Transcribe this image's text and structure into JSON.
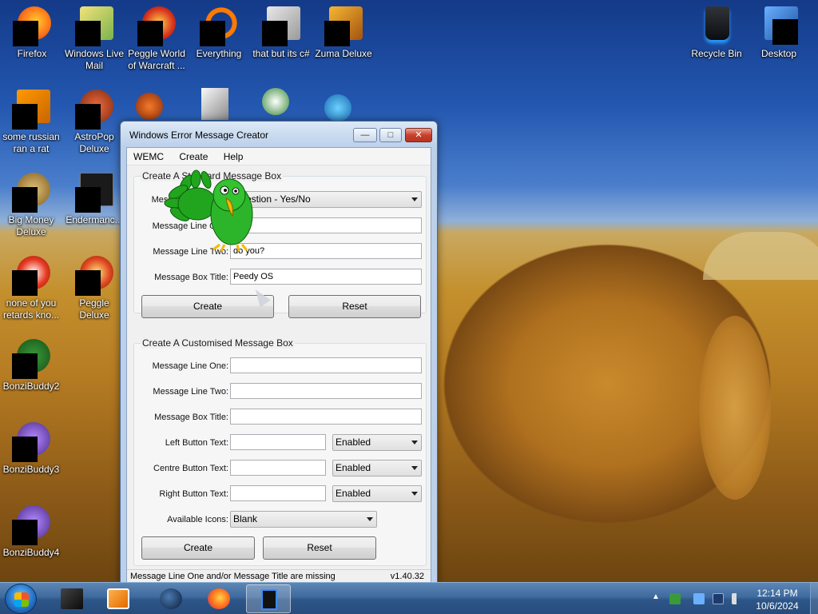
{
  "desktop": {
    "icons": [
      {
        "label": "Firefox"
      },
      {
        "label": "Windows Live Mail"
      },
      {
        "label": "Peggle World of Warcraft ..."
      },
      {
        "label": "Everything"
      },
      {
        "label": "that but its c#"
      },
      {
        "label": "Zuma Deluxe"
      },
      {
        "label": "Recycle Bin"
      },
      {
        "label": "Desktop"
      },
      {
        "label": "some russian ran a rat"
      },
      {
        "label": "AstroPop Deluxe"
      },
      {
        "label": "Big Money Deluxe"
      },
      {
        "label": "Endermanc..."
      },
      {
        "label": "none of you retards kno..."
      },
      {
        "label": "Peggle Deluxe"
      },
      {
        "label": "BonziBuddy2"
      },
      {
        "label": "BonziBuddy3"
      },
      {
        "label": "BonziBuddy4"
      }
    ]
  },
  "window": {
    "title": "Windows Error Message Creator",
    "menu": [
      "WEMC",
      "Create",
      "Help"
    ],
    "standard": {
      "group_title": "Create A Standard Message Box",
      "type_label": "Message Box Type:",
      "type_value": "Question - Yes/No",
      "line1_label": "Message Line One:",
      "line1_value": "",
      "line2_label": "Message Line Two:",
      "line2_value": "do you?",
      "title_label": "Message Box Title:",
      "title_value": "Peedy OS",
      "create_label": "Create",
      "reset_label": "Reset"
    },
    "custom": {
      "group_title": "Create A Customised Message Box",
      "line1_label": "Message Line One:",
      "line2_label": "Message Line Two:",
      "title_label": "Message Box Title:",
      "left_label": "Left Button Text:",
      "left_state": "Enabled",
      "centre_label": "Centre Button Text:",
      "centre_state": "Enabled",
      "right_label": "Right Button Text:",
      "right_state": "Enabled",
      "icons_label": "Available Icons:",
      "icons_value": "Blank",
      "create_label": "Create",
      "reset_label": "Reset"
    },
    "status": "Message Line One and/or Message Title are missing",
    "version": "v1.40.32"
  },
  "taskbar": {
    "time": "12:14 PM",
    "date": "10/6/2024"
  }
}
